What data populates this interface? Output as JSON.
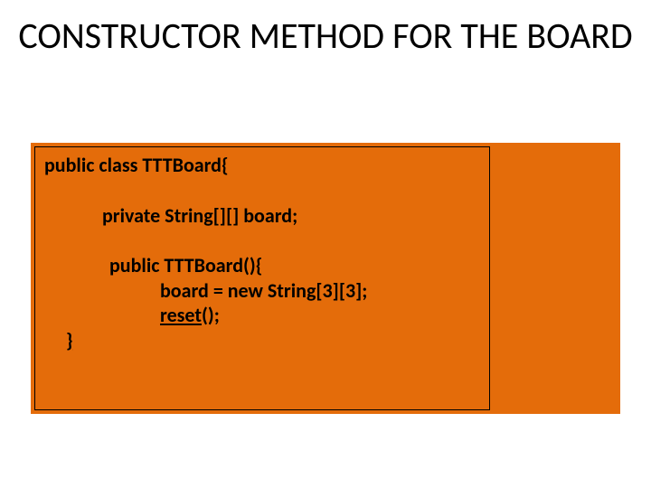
{
  "title": "CONSTRUCTOR METHOD FOR THE BOARD",
  "code": {
    "line1": "public class TTTBoard{",
    "line2": "private String[][] board;",
    "line3": "public TTTBoard(){",
    "line4": "board = new String[3][3];",
    "line5a": "reset",
    "line5b": "();",
    "line6": "}"
  }
}
